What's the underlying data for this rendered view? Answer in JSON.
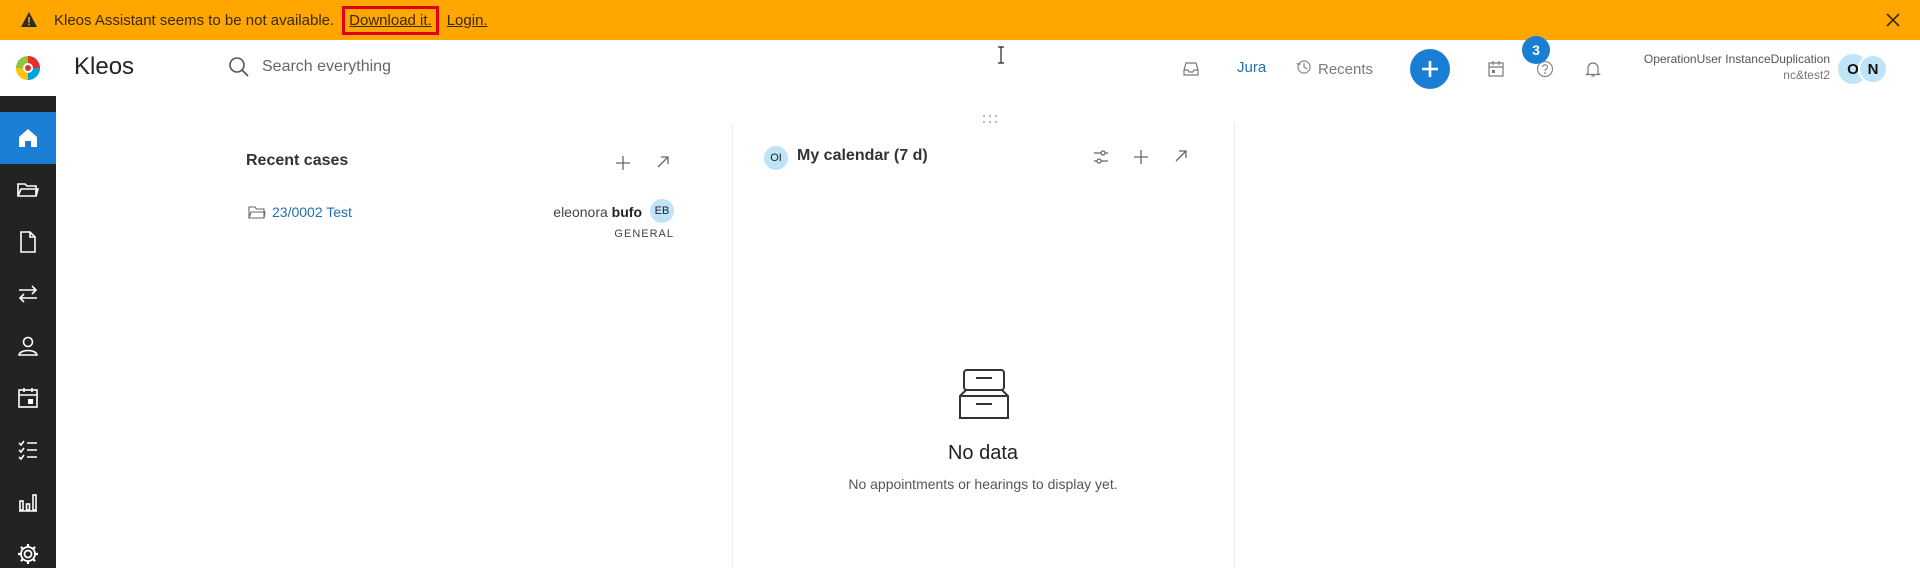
{
  "banner": {
    "message": "Kleos Assistant seems to be not available.",
    "download_label": "Download it.",
    "login_label": "Login."
  },
  "header": {
    "brand": "Kleos",
    "search_placeholder": "Search everything",
    "jura_label": "Jura",
    "recents_label": "Recents",
    "help_badge": "3",
    "user_name": "OperationUser InstanceDuplication",
    "user_sub": "nc&test2",
    "avatar_initials": [
      "O",
      "N"
    ]
  },
  "sidebar": {
    "items": [
      {
        "name": "home",
        "active": true
      },
      {
        "name": "cases"
      },
      {
        "name": "documents"
      },
      {
        "name": "transfers"
      },
      {
        "name": "contacts"
      },
      {
        "name": "calendar"
      },
      {
        "name": "tasks"
      },
      {
        "name": "reports"
      },
      {
        "name": "settings"
      }
    ]
  },
  "recent_cases": {
    "title": "Recent cases",
    "rows": [
      {
        "case_number": "23/0002 Test",
        "owner_first": "eleonora",
        "owner_last": "bufo",
        "initials": "EB",
        "tag": "GENERAL"
      }
    ]
  },
  "calendar": {
    "owner_initials": "OI",
    "title": "My calendar (7 d)",
    "empty_title": "No data",
    "empty_message": "No appointments or hearings to display yet."
  },
  "colors": {
    "banner": "#ffa600",
    "accent": "#1a7fd4",
    "sidebar": "#232323",
    "avatar": "#bfe4f8",
    "link": "#1f6fb0"
  }
}
